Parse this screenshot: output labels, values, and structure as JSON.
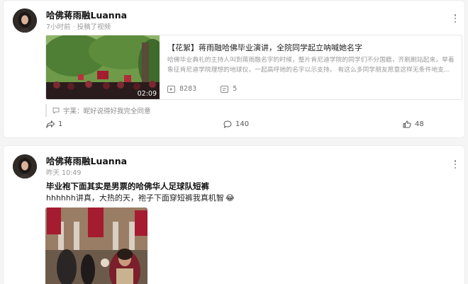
{
  "posts": [
    {
      "username": "哈佛蒋雨融Luanna",
      "meta": "7小时前 · 投稿了视频",
      "share": {
        "title": "【花絮】蒋雨融哈佛毕业演讲，全院同学起立呐喊她名字",
        "description": "哈佛毕业典礼的主持人叫到蒋雨融名字的时候，整片肯尼迪学院的同学们不分国籍，齐刷刷站起来，举着象征肯尼迪学院理想的地球仪，一起高呼她的名字以示支持。 有这么多同学朋友愿意这样无条件地支...",
        "duration": "02:09",
        "plays": "8283",
        "danmaku": "5"
      },
      "comment": "宇莱：昵好说得好我完全同意",
      "actions": {
        "reposts": "1",
        "comments": "140",
        "likes": "48"
      }
    },
    {
      "username": "哈佛蒋雨融Luanna",
      "meta": "昨天 10:49",
      "title": "毕业袍下面其实是男票的哈佛华人足球队短裤",
      "text": "hhhhhh讲真，大热的天，袍子下面穿短裤我真机智",
      "emoji": "😂"
    }
  ],
  "icons": {
    "more": "more-vertical-icon",
    "play": "play-count-icon",
    "danmaku": "danmaku-icon",
    "comment": "comment-bubble-icon",
    "repost": "repost-icon",
    "like": "thumbs-up-icon"
  },
  "colors": {
    "page_bg": "#f5f5f5",
    "card_bg": "#ffffff",
    "muted_text": "#9a9a9a",
    "harvard_crimson": "#a51c30"
  }
}
